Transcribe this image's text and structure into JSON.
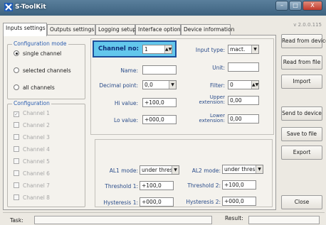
{
  "window": {
    "title": "S-ToolKit",
    "version": "v 2.0.0.115",
    "buttons": [
      "–",
      "□",
      "X"
    ]
  },
  "tabs": [
    "Inputs settings",
    "Outputs settings",
    "Logging setup",
    "Interface options",
    "Device information"
  ],
  "config_mode": {
    "title": "Configuration mode",
    "options": [
      "single channel",
      "selected channels",
      "all channels"
    ],
    "selected": "single channel"
  },
  "configuration": {
    "title": "Configuration",
    "channels": [
      "Channel 1",
      "Channel 2",
      "Channel 3",
      "Channel 4",
      "Channel 5",
      "Channel 6",
      "Channel 7",
      "Channel 8"
    ],
    "checked": [
      true,
      false,
      false,
      false,
      false,
      false,
      false,
      false
    ]
  },
  "channel": {
    "label": "Channel no:",
    "value": "1"
  },
  "fields": {
    "name_label": "Name:",
    "name_value": "",
    "decimal_label": "Decimal point:",
    "decimal_value": "0,0",
    "hi_label": "Hi value:",
    "hi_value": "+100,0",
    "lo_label": "Lo value:",
    "lo_value": "+000,0",
    "input_type_label": "Input type:",
    "input_type_value": "mact.",
    "unit_label": "Unit:",
    "unit_value": "",
    "filter_label": "Filter:",
    "filter_value": "0",
    "upper_ext_label_1": "Upper",
    "upper_ext_label_2": "extension:",
    "upper_ext_value": "0,00",
    "lower_ext_label_1": "Lower",
    "lower_ext_label_2": "extension:",
    "lower_ext_value": "0,00"
  },
  "alarms": {
    "al1_label": "AL1 mode:",
    "al1_value": "under thresh.",
    "al2_label": "AL2 mode:",
    "al2_value": "under thresh.",
    "thr1_label": "Threshold 1:",
    "thr1_value": "+100,0",
    "thr2_label": "Threshold 2:",
    "thr2_value": "+100,0",
    "hyst1_label": "Hysteresis 1:",
    "hyst1_value": "+000,0",
    "hyst2_label": "Hysteresis 2:",
    "hyst2_value": "+000,0"
  },
  "side_buttons": {
    "read_device": "Read from device",
    "read_file": "Read from file",
    "import": "Import",
    "send_device": "Send to device",
    "save_file": "Save to file",
    "export": "Export",
    "close": "Close"
  },
  "status": {
    "task_label": "Task:",
    "result_label": "Result:"
  }
}
